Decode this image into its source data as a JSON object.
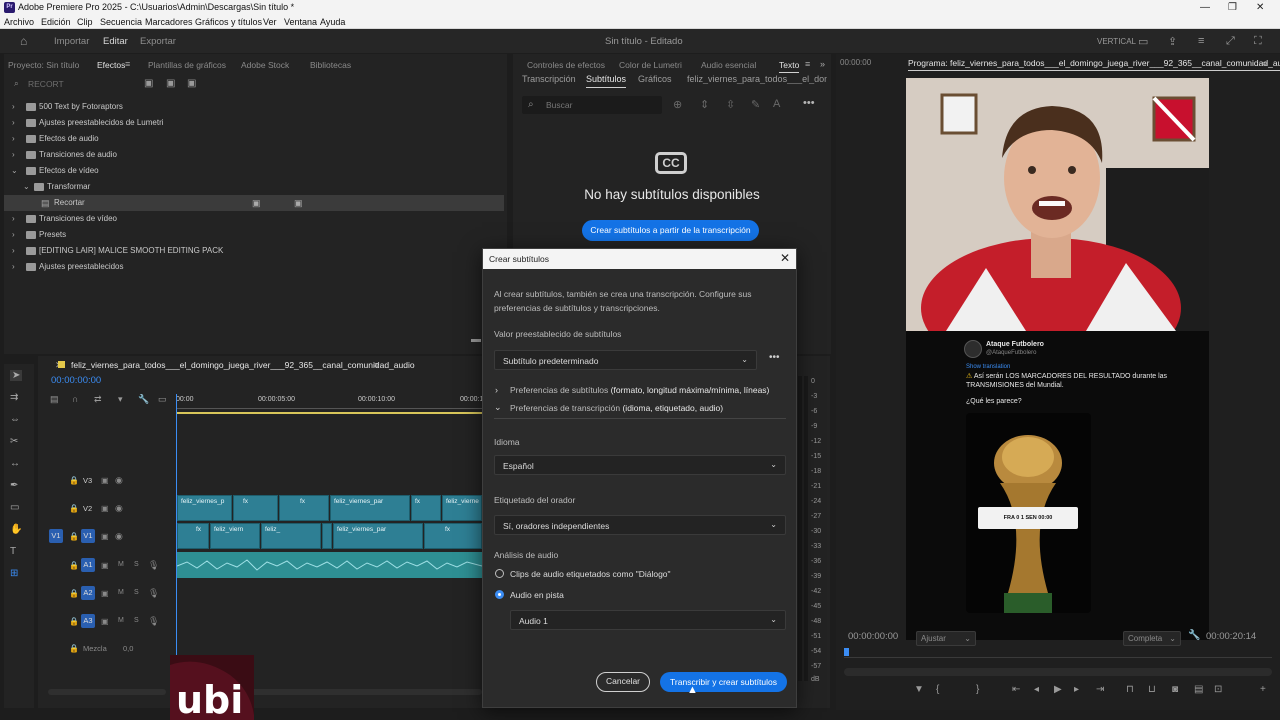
{
  "window": {
    "title": "Adobe Premiere Pro 2025 - C:\\Usuarios\\Admin\\Descargas\\Sin título *",
    "app_icon": "Pr"
  },
  "menu": [
    "Archivo",
    "Edición",
    "Clip",
    "Secuencia",
    "Marcadores",
    "Gráficos y títulos",
    "Ver",
    "Ventana",
    "Ayuda"
  ],
  "workspace": {
    "tabs": [
      "Importar",
      "Editar",
      "Exportar"
    ],
    "active_tab": "Editar",
    "project_title": "Sin título - Editado",
    "layout_label": "VERTICAL"
  },
  "effects_panel": {
    "tabs": [
      "Proyecto: Sin título",
      "Efectos",
      "Plantillas de gráficos",
      "Adobe Stock",
      "Bibliotecas"
    ],
    "active_tab": "Efectos",
    "search_value": "RECORT",
    "tree": [
      {
        "label": "500 Text by Fotoraptors",
        "expanded": false
      },
      {
        "label": "Ajustes preestablecidos de Lumetri",
        "expanded": false
      },
      {
        "label": "Efectos de audio",
        "expanded": false
      },
      {
        "label": "Transiciones de audio",
        "expanded": false
      },
      {
        "label": "Efectos de vídeo",
        "expanded": true
      },
      {
        "label": "Transformar",
        "expanded": true
      },
      {
        "label": "Recortar",
        "selected": true
      },
      {
        "label": "Transiciones de vídeo",
        "expanded": false
      },
      {
        "label": "Presets",
        "expanded": false
      },
      {
        "label": "[EDITING LAIR] MALICE SMOOTH EDITING PACK",
        "expanded": false
      },
      {
        "label": "Ajustes preestablecidos",
        "expanded": false
      }
    ]
  },
  "text_panel": {
    "top_tabs": [
      "Controles de efectos",
      "Color de Lumetri",
      "Audio esencial",
      "Texto"
    ],
    "active_top_tab": "Texto",
    "sub_tabs": [
      "Transcripción",
      "Subtítulos",
      "Gráficos",
      "feliz_viernes_para_todos___el_domi"
    ],
    "active_sub_tab": "Subtítulos",
    "search_placeholder": "Buscar",
    "empty_message": "No hay subtítulos disponibles",
    "create_button": "Crear subtítulos a partir de la transcripción",
    "cc_label": "CC"
  },
  "program_monitor": {
    "source_time": "00:00:00",
    "title": "Programa: feliz_viernes_para_todos___el_domingo_juega_river___92_365__canal_comunidad_audio",
    "timecode_start": "00:00:00:00",
    "fit": "Ajustar",
    "quality": "Completa",
    "timecode_end": "00:00:20:14",
    "tweet": {
      "account": "Ataque Futbolero",
      "handle": "@AtaqueFutbolero",
      "translate": "Show translation",
      "text": "Así serán LOS MARCADORES DEL RESULTADO durante las TRANSMISIONES del Mundial.",
      "question": "¿Qué les parece?",
      "scoreboard": "FRA 0 1 SEN 00:00"
    }
  },
  "timeline": {
    "sequence_name": "feliz_viernes_para_todos___el_domingo_juega_river___92_365__canal_comunidad_audio",
    "current_time": "00:00:00:00",
    "ruler_labels": [
      "00:00",
      "00:00:05:00",
      "00:00:10:00",
      "00:00:1"
    ],
    "video_tracks": [
      "V3",
      "V2",
      "V1"
    ],
    "audio_tracks": [
      "A1",
      "A2",
      "A3"
    ],
    "mix_label": "Mezcla",
    "mix_value": "0,0",
    "clip_names": [
      "feliz_viernes_p",
      "feliz_viernes_par",
      "feliz_viern",
      "feliz_",
      "feliz_viernes_par",
      "feliz_vierne"
    ],
    "fx_label": "fx",
    "track_btns": [
      "M",
      "S"
    ]
  },
  "meter_labels": [
    "0",
    "-3",
    "-6",
    "-9",
    "-12",
    "-15",
    "-18",
    "-21",
    "-24",
    "-27",
    "-30",
    "-33",
    "-36",
    "-39",
    "-42",
    "-45",
    "-48",
    "-51",
    "-54",
    "-57",
    "dB"
  ],
  "dialog": {
    "title": "Crear subtítulos",
    "intro": "Al crear subtítulos, también se crea una transcripción. Configure sus preferencias de subtítulos y transcripciones.",
    "preset_label": "Valor preestablecido de subtítulos",
    "preset_value": "Subtítulo predeterminado",
    "pref_subs_a": "Preferencias de subtítulos",
    "pref_subs_b": "(formato, longitud máxima/mínima, líneas)",
    "pref_trans_a": "Preferencias de transcripción",
    "pref_trans_b": "(idioma, etiquetado, audio)",
    "language_label": "Idioma",
    "language_value": "Español",
    "speaker_label": "Etiquetado del orador",
    "speaker_value": "Sí, oradores independientes",
    "audio_label": "Análisis de audio",
    "radio1": "Clips de audio etiquetados como \"Diálogo\"",
    "radio2": "Audio en pista",
    "track_value": "Audio 1",
    "cancel": "Cancelar",
    "confirm": "Transcribir y crear subtítulos"
  },
  "logo_text": "ubi",
  "colors": {
    "accent": "#1473e6",
    "clip": "#2e7f94",
    "playhead": "#3b8df4"
  }
}
